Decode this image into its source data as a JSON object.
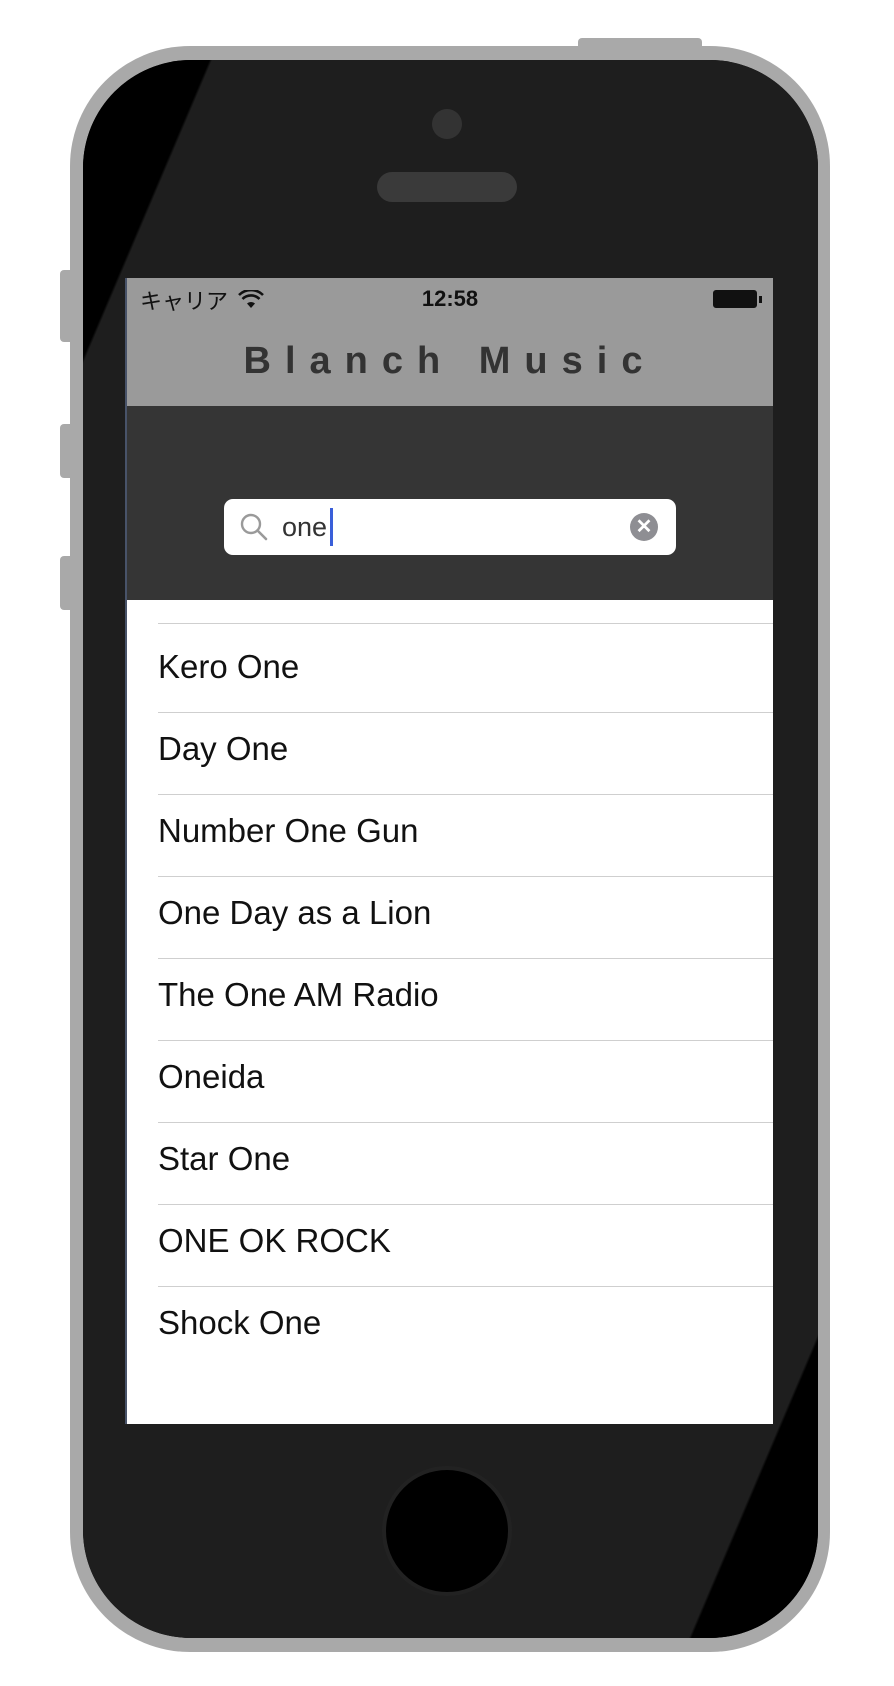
{
  "status_bar": {
    "carrier": "キャリア",
    "time": "12:58"
  },
  "nav": {
    "title": "Blanch Music"
  },
  "search": {
    "value": "one",
    "icon": "search-icon",
    "clear_icon": "clear-icon"
  },
  "results": [
    "Kero One",
    "Day One",
    "Number One Gun",
    "One Day as a Lion",
    "The One AM Radio",
    "Oneida",
    "Star One",
    "ONE OK ROCK",
    "Shock One"
  ],
  "colors": {
    "nav_background": "#9a9a9a",
    "search_background": "#353535",
    "caret": "#3a5fd9"
  }
}
